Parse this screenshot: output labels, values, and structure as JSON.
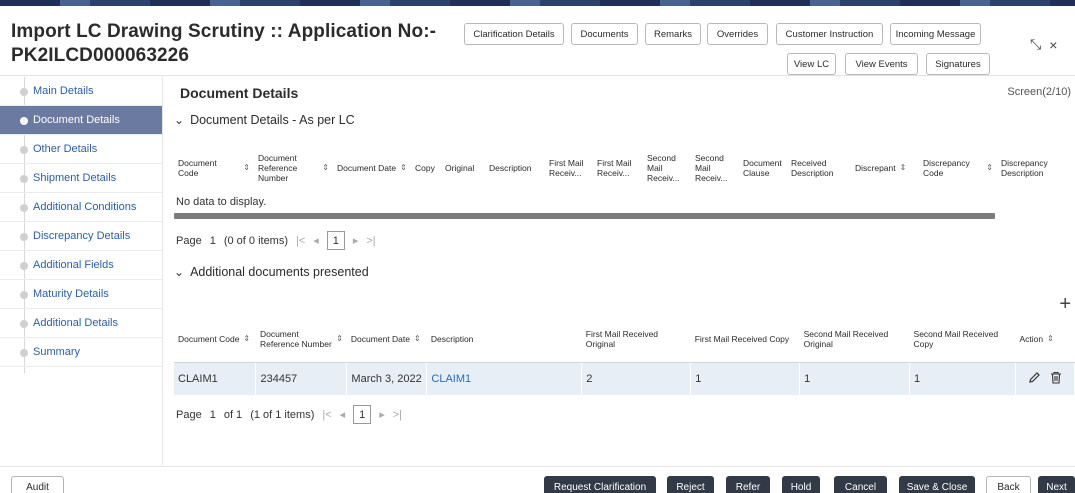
{
  "header": {
    "title_line1": "Import LC Drawing Scrutiny :: Application No:-",
    "title_line2": "PK2ILCD000063226",
    "buttons": {
      "clarification_details": "Clarification Details",
      "documents": "Documents",
      "remarks": "Remarks",
      "overrides": "Overrides",
      "customer_instruction": "Customer Instruction",
      "incoming_message": "Incoming Message",
      "view_lc": "View LC",
      "view_events": "View Events",
      "signatures": "Signatures"
    },
    "window_controls": {
      "resize": "⤡",
      "close": "×"
    }
  },
  "sidebar": {
    "items": [
      {
        "label": "Main Details"
      },
      {
        "label": "Document Details"
      },
      {
        "label": "Other Details"
      },
      {
        "label": "Shipment Details"
      },
      {
        "label": "Additional Conditions"
      },
      {
        "label": "Discrepancy Details"
      },
      {
        "label": "Additional Fields"
      },
      {
        "label": "Maturity Details"
      },
      {
        "label": "Additional Details"
      },
      {
        "label": "Summary"
      }
    ],
    "active_index": 1
  },
  "main": {
    "heading": "Document Details",
    "screen_indicator": "Screen(2/10)",
    "section1": {
      "title": "Document Details - As per LC",
      "columns": [
        {
          "label": "Document Code",
          "sortable": true
        },
        {
          "label": "Document Reference Number",
          "sortable": true
        },
        {
          "label": "Document Date",
          "sortable": true
        },
        {
          "label": "Copy",
          "sortable": false
        },
        {
          "label": "Original",
          "sortable": false
        },
        {
          "label": "Description",
          "sortable": false
        },
        {
          "label": "First Mail Receiv...",
          "sortable": false
        },
        {
          "label": "First Mail Receiv...",
          "sortable": false
        },
        {
          "label": "Second Mail Receiv...",
          "sortable": false
        },
        {
          "label": "Second Mail Receiv...",
          "sortable": false
        },
        {
          "label": "Document Clause",
          "sortable": false
        },
        {
          "label": "Received Description",
          "sortable": false
        },
        {
          "label": "Discrepant",
          "sortable": true
        },
        {
          "label": "Discrepancy Code",
          "sortable": true
        },
        {
          "label": "Discrepancy Description",
          "sortable": false
        }
      ],
      "empty_message": "No data to display.",
      "pager": {
        "page_label": "Page",
        "page": "1",
        "info": "(0 of 0 items)",
        "current": "1"
      }
    },
    "section2": {
      "title": "Additional documents presented",
      "columns": [
        {
          "label": "Document Code",
          "sortable": true
        },
        {
          "label": "Document Reference Number",
          "sortable": true
        },
        {
          "label": "Document Date",
          "sortable": true
        },
        {
          "label": "Description",
          "sortable": false
        },
        {
          "label": "First Mail Received Original",
          "sortable": false
        },
        {
          "label": "First Mail Received Copy",
          "sortable": false
        },
        {
          "label": "Second Mail Received Original",
          "sortable": false
        },
        {
          "label": "Second Mail Received Copy",
          "sortable": false
        },
        {
          "label": "Action",
          "sortable": true
        }
      ],
      "rows": [
        {
          "code": "CLAIM1",
          "ref": "234457",
          "date": "March 3, 2022",
          "description": "CLAIM1",
          "first_orig": "2",
          "first_copy": "1",
          "second_orig": "1",
          "second_copy": "1"
        }
      ],
      "pager": {
        "page_label": "Page",
        "page": "1",
        "of": "of 1",
        "info": "(1 of 1 items)",
        "current": "1"
      },
      "add_icon": "+"
    }
  },
  "footer": {
    "audit": "Audit",
    "buttons": {
      "request_clarification": "Request Clarification",
      "reject": "Reject",
      "refer": "Refer",
      "hold": "Hold",
      "cancel": "Cancel",
      "save_close": "Save & Close",
      "back": "Back",
      "next": "Next"
    }
  },
  "colors": {
    "sidebar_active_bg": "#6b7aa0",
    "link": "#2c6bb0",
    "footer_button_dark": "#323a48",
    "row_bg": "#e8eef6"
  }
}
